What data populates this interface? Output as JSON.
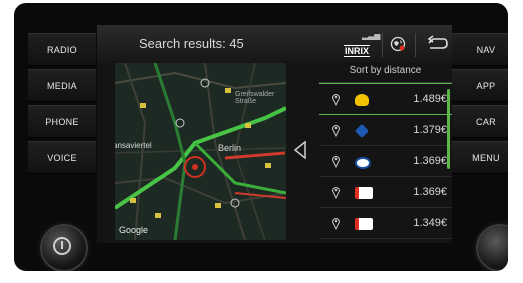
{
  "header": {
    "title": "Search results: 45",
    "provider": "INRIX"
  },
  "left_buttons": [
    "RADIO",
    "MEDIA",
    "PHONE",
    "VOICE"
  ],
  "right_buttons": [
    "NAV",
    "APP",
    "CAR",
    "MENU"
  ],
  "map": {
    "labels": [
      "ansaviertel",
      "Berlin",
      "Google",
      "Greifswalder Straße"
    ],
    "attribution": "Google"
  },
  "results": {
    "sort_label": "Sort by distance",
    "items": [
      {
        "brand_icon": "shell-logo-icon",
        "price": "1.489€",
        "color": "#f2c200"
      },
      {
        "brand_icon": "aral-logo-icon",
        "price": "1.379€",
        "color": "#1e5ab4"
      },
      {
        "brand_icon": "esso-logo-icon",
        "price": "1.369€",
        "color": "#1a4fa0"
      },
      {
        "brand_icon": "total-logo-icon",
        "price": "1.369€",
        "color": "#e03020"
      },
      {
        "brand_icon": "total-logo-icon",
        "price": "1.349€",
        "color": "#e03020"
      }
    ]
  },
  "colors": {
    "accent": "#5bb64a",
    "route": "#4cd44a"
  }
}
